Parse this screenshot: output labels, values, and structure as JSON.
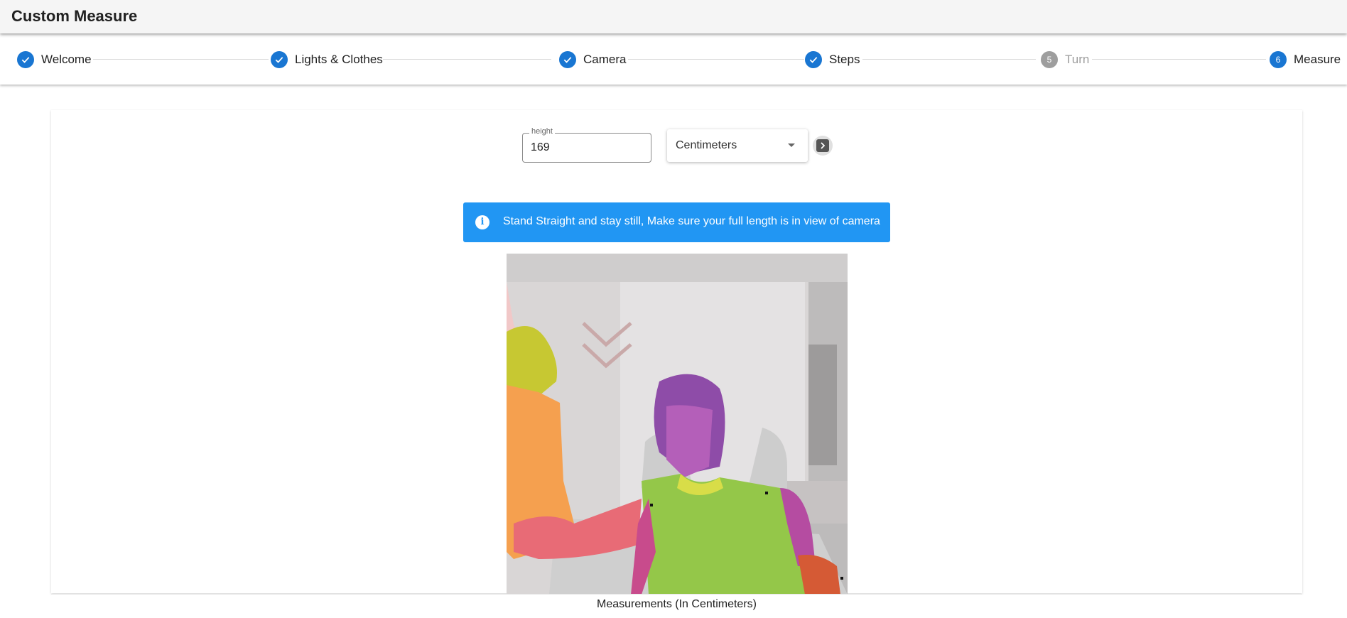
{
  "app": {
    "title": "Custom Measure"
  },
  "stepper": {
    "steps": [
      {
        "label": "Welcome",
        "state": "completed",
        "number": ""
      },
      {
        "label": "Lights & Clothes",
        "state": "completed",
        "number": ""
      },
      {
        "label": "Camera",
        "state": "completed",
        "number": ""
      },
      {
        "label": "Steps",
        "state": "completed",
        "number": ""
      },
      {
        "label": "Turn",
        "state": "disabled",
        "number": "5"
      },
      {
        "label": "Measure",
        "state": "active",
        "number": "6"
      }
    ]
  },
  "form": {
    "height": {
      "label": "height",
      "value": "169"
    },
    "unit": {
      "selected": "Centimeters"
    },
    "next_icon": "chevron-right-icon"
  },
  "alert": {
    "icon": "info-icon",
    "text": "Stand Straight and stay still, Make sure your full length is in view of camera",
    "color": "#2196f3"
  },
  "camera": {
    "content": "segmented-body-camera-feed"
  },
  "measurements": {
    "title": "Measurements (In Centimeters)"
  },
  "colors": {
    "primary": "#1976d2",
    "disabled": "#9e9e9e",
    "info": "#2196f3"
  }
}
